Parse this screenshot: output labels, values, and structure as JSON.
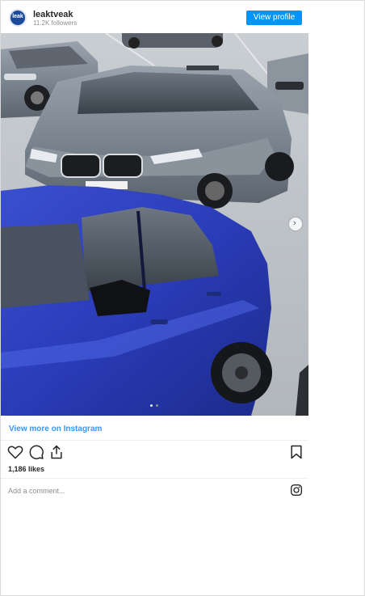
{
  "account": {
    "avatar_text": "leak",
    "username": "leaktveak",
    "followers": "11.2K followers",
    "view_profile_label": "View profile"
  },
  "carousel": {
    "current_slide": 1,
    "total_slides": 2,
    "next_icon": "chevron-right-icon"
  },
  "view_more_label": "View more on Instagram",
  "actions": {
    "icons": [
      "heart-icon",
      "comment-icon",
      "share-icon",
      "bookmark-icon"
    ]
  },
  "likes": "1,186 likes",
  "comment": {
    "placeholder": "Add a comment...",
    "icon": "instagram-icon"
  },
  "colors": {
    "primary": "#0095f6",
    "link": "#3897f0",
    "text": "#262626",
    "muted": "#8e8e8e"
  }
}
